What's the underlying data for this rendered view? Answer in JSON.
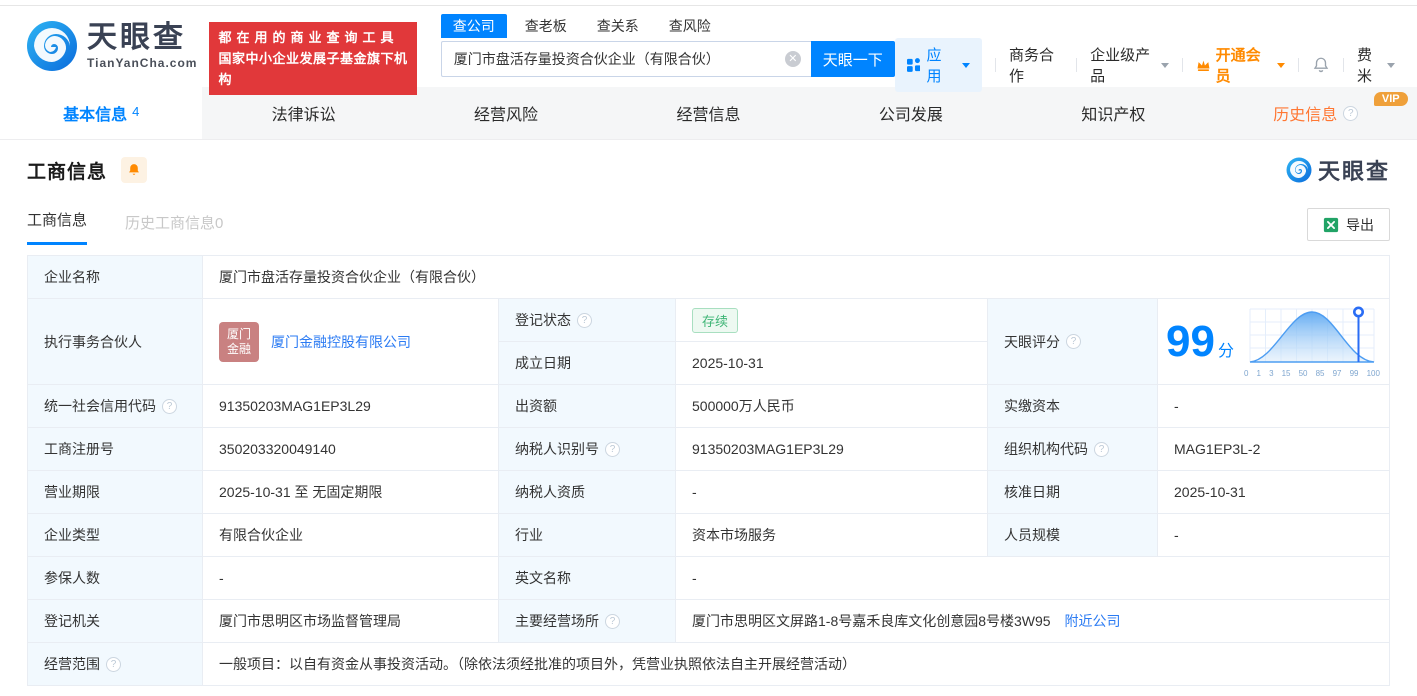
{
  "colors": {
    "brand_blue": "#0084ff",
    "promo_red": "#e1383a",
    "vip_orange": "#ff8a00",
    "history_tab_orange": "#ff7733",
    "status_green": "#3eb575",
    "link_blue": "#2b7bf3",
    "label_cell_bg": "#f2f9fe"
  },
  "header": {
    "logo": {
      "brand": "天眼查",
      "domain": "TianYanCha.com"
    },
    "promo": {
      "line1": "都在用的商业查询工具",
      "line2": "国家中小企业发展子基金旗下机构"
    },
    "search": {
      "tabs": [
        {
          "label": "查公司"
        },
        {
          "label": "查老板"
        },
        {
          "label": "查关系"
        },
        {
          "label": "查风险"
        }
      ],
      "value": "厦门市盘活存量投资合伙企业（有限合伙）",
      "button": "天眼一下"
    },
    "nav": {
      "apps": "应用",
      "cooperation": "商务合作",
      "enterprise": "企业级产品",
      "vip": "开通会员",
      "user": "费米"
    }
  },
  "tabs": [
    {
      "label": "基本信息",
      "count": "4"
    },
    {
      "label": "法律诉讼"
    },
    {
      "label": "经营风险"
    },
    {
      "label": "经营信息"
    },
    {
      "label": "公司发展"
    },
    {
      "label": "知识产权"
    },
    {
      "label": "历史信息",
      "badge": "VIP"
    }
  ],
  "section": {
    "title": "工商信息",
    "brand": "天眼查",
    "subtabs": [
      {
        "label": "工商信息"
      },
      {
        "label": "历史工商信息0"
      }
    ],
    "export": "导出"
  },
  "score": {
    "label": "天眼评分",
    "value": "99",
    "unit": "分",
    "axis": [
      "0",
      "1",
      "3",
      "15",
      "50",
      "85",
      "97",
      "99",
      "100"
    ]
  },
  "table": {
    "row1": {
      "label": "企业名称",
      "value": "厦门市盘活存量投资合伙企业（有限合伙）"
    },
    "row2": {
      "label": "执行事务合伙人",
      "avatar_line1": "厦门",
      "avatar_line2": "金融",
      "partner": "厦门金融控股有限公司",
      "status_label": "登记状态",
      "status_value": "存续",
      "date_label": "成立日期",
      "date_value": "2025-10-31"
    },
    "row3": {
      "l1": "统一社会信用代码",
      "v1": "91350203MAG1EP3L29",
      "l2": "出资额",
      "v2": "500000万人民币",
      "l3": "实缴资本",
      "v3": "-"
    },
    "row4": {
      "l1": "工商注册号",
      "v1": "350203320049140",
      "l2": "纳税人识别号",
      "v2": "91350203MAG1EP3L29",
      "l3": "组织机构代码",
      "v3": "MAG1EP3L-2"
    },
    "row5": {
      "l1": "营业期限",
      "v1": "2025-10-31 至 无固定期限",
      "l2": "纳税人资质",
      "v2": "-",
      "l3": "核准日期",
      "v3": "2025-10-31"
    },
    "row6": {
      "l1": "企业类型",
      "v1": "有限合伙企业",
      "l2": "行业",
      "v2": "资本市场服务",
      "l3": "人员规模",
      "v3": "-"
    },
    "row7": {
      "l1": "参保人数",
      "v1": "-",
      "l2": "英文名称",
      "v2": "-"
    },
    "row8": {
      "l1": "登记机关",
      "v1": "厦门市思明区市场监督管理局",
      "l2": "主要经营场所",
      "v2": "厦门市思明区文屏路1-8号嘉禾良库文化创意园8号楼3W95",
      "link": "附近公司"
    },
    "row9": {
      "l1": "经营范围",
      "v1": "一般项目：以自有资金从事投资活动。（除依法须经批准的项目外，凭营业执照依法自主开展经营活动）"
    }
  }
}
